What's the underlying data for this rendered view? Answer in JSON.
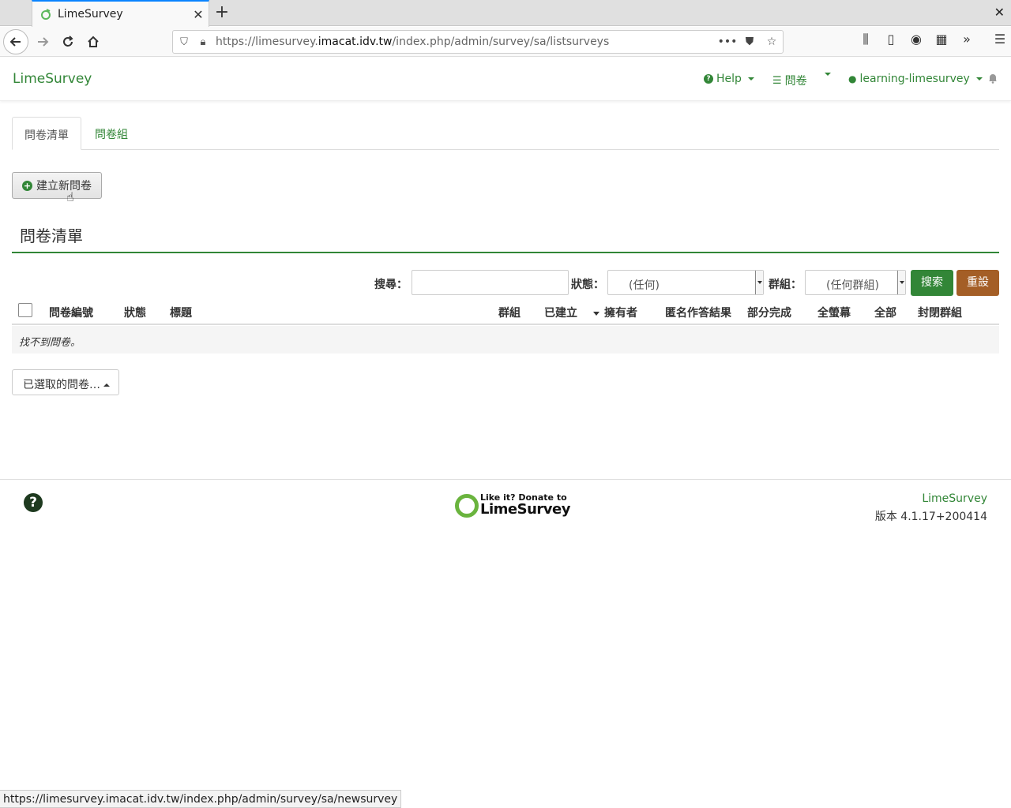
{
  "browser": {
    "tab_title": "LimeSurvey",
    "url_prefix": "https://limesurvey.",
    "url_host": "imacat.idv.tw",
    "url_path": "/index.php/admin/survey/sa/listsurveys",
    "status_url": "https://limesurvey.imacat.idv.tw/index.php/admin/survey/sa/newsurvey"
  },
  "topnav": {
    "brand": "LimeSurvey",
    "help": "Help",
    "surveys": "問卷",
    "user": "learning-limesurvey"
  },
  "tabs": [
    {
      "label": "問卷清單"
    },
    {
      "label": "問卷組"
    }
  ],
  "create_button": "建立新問卷",
  "section_title": "問卷清單",
  "filters": {
    "search_label": "搜尋：",
    "search_value": "",
    "status_label": "狀態：",
    "status_value": "(任何)",
    "group_label": "群組：",
    "group_value": "(任何群組)",
    "search_button": "搜索",
    "reset_button": "重設"
  },
  "table": {
    "headers": [
      "問卷編號",
      "狀態",
      "標題",
      "群組",
      "已建立",
      "擁有者",
      "匿名作答結果",
      "部分完成",
      "全螢幕",
      "全部",
      "封閉群組"
    ],
    "empty_message": "找不到問卷。"
  },
  "selected_button": "已選取的問卷…",
  "footer": {
    "donate_line1": "Like it? Donate to",
    "donate_line2": "LimeSurvey",
    "brand": "LimeSurvey",
    "version": "版本 4.1.17+200414"
  },
  "colors": {
    "accent": "#328637",
    "reset": "#a45e26"
  }
}
